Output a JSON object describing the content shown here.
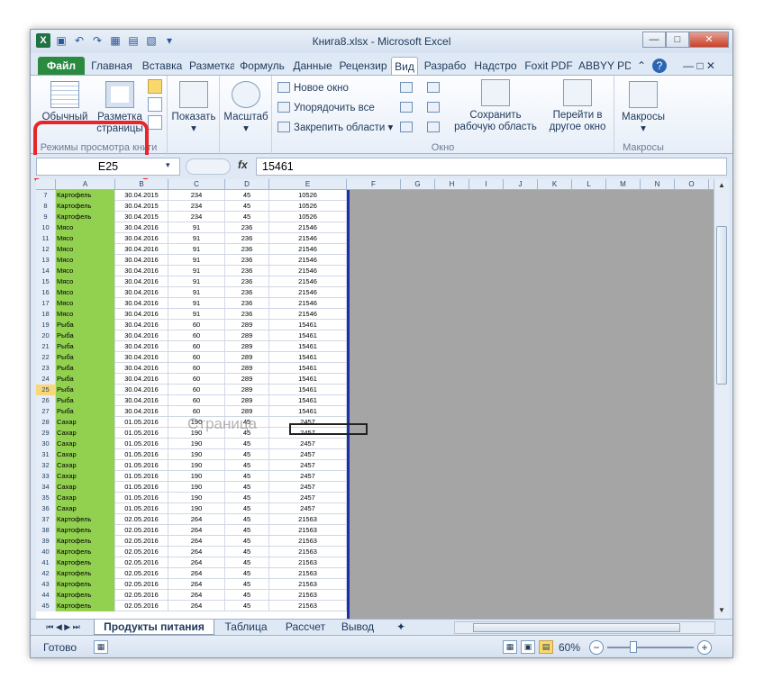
{
  "window": {
    "title": "Книга8.xlsx - Microsoft Excel"
  },
  "ribbon_tabs": [
    "Файл",
    "Главная",
    "Вставка",
    "Разметка",
    "Формуль",
    "Данные",
    "Рецензир",
    "Вид",
    "Разрабо",
    "Надстро",
    "Foxit PDF",
    "ABBYY PD"
  ],
  "ribbon": {
    "normal": "Обычный",
    "page_layout_1": "Разметка",
    "page_layout_2": "страницы",
    "views_group": "Режимы просмотра книги",
    "show": "Показать",
    "zoom": "Масштаб",
    "new_window": "Новое окно",
    "arrange_all": "Упорядочить все",
    "freeze": "Закрепить области",
    "save_ws_1": "Сохранить",
    "save_ws_2": "рабочую область",
    "switch_1": "Перейти в",
    "switch_2": "другое окно",
    "window_group": "Окно",
    "macros": "Макросы",
    "macros_group": "Макросы"
  },
  "formula_bar": {
    "name_box": "E25",
    "fx": "fx",
    "value": "15461"
  },
  "columns": [
    "A",
    "B",
    "C",
    "D",
    "E",
    "F",
    "G",
    "H",
    "I",
    "J",
    "K",
    "L",
    "M",
    "N",
    "O"
  ],
  "rows": [
    [
      "7",
      "Картофель",
      "30.04.2015",
      "234",
      "45",
      "10526"
    ],
    [
      "8",
      "Картофель",
      "30.04.2015",
      "234",
      "45",
      "10526"
    ],
    [
      "9",
      "Картофель",
      "30.04.2015",
      "234",
      "45",
      "10526"
    ],
    [
      "10",
      "Мясо",
      "30.04.2016",
      "91",
      "236",
      "21546"
    ],
    [
      "11",
      "Мясо",
      "30.04.2016",
      "91",
      "236",
      "21546"
    ],
    [
      "12",
      "Мясо",
      "30.04.2016",
      "91",
      "236",
      "21546"
    ],
    [
      "13",
      "Мясо",
      "30.04.2016",
      "91",
      "236",
      "21546"
    ],
    [
      "14",
      "Мясо",
      "30.04.2016",
      "91",
      "236",
      "21546"
    ],
    [
      "15",
      "Мясо",
      "30.04.2016",
      "91",
      "236",
      "21546"
    ],
    [
      "16",
      "Мясо",
      "30.04.2016",
      "91",
      "236",
      "21546"
    ],
    [
      "17",
      "Мясо",
      "30.04.2016",
      "91",
      "236",
      "21546"
    ],
    [
      "18",
      "Мясо",
      "30.04.2016",
      "91",
      "236",
      "21546"
    ],
    [
      "19",
      "Рыба",
      "30.04.2016",
      "60",
      "289",
      "15461"
    ],
    [
      "20",
      "Рыба",
      "30.04.2016",
      "60",
      "289",
      "15461"
    ],
    [
      "21",
      "Рыба",
      "30.04.2016",
      "60",
      "289",
      "15461"
    ],
    [
      "22",
      "Рыба",
      "30.04.2016",
      "60",
      "289",
      "15461"
    ],
    [
      "23",
      "Рыба",
      "30.04.2016",
      "60",
      "289",
      "15461"
    ],
    [
      "24",
      "Рыба",
      "30.04.2016",
      "60",
      "289",
      "15461"
    ],
    [
      "25",
      "Рыба",
      "30.04.2016",
      "60",
      "289",
      "15461"
    ],
    [
      "26",
      "Рыба",
      "30.04.2016",
      "60",
      "289",
      "15461"
    ],
    [
      "27",
      "Рыба",
      "30.04.2016",
      "60",
      "289",
      "15461"
    ],
    [
      "28",
      "Сахар",
      "01.05.2016",
      "190",
      "45",
      "2457"
    ],
    [
      "29",
      "Сахар",
      "01.05.2016",
      "190",
      "45",
      "2457"
    ],
    [
      "30",
      "Сахар",
      "01.05.2016",
      "190",
      "45",
      "2457"
    ],
    [
      "31",
      "Сахар",
      "01.05.2016",
      "190",
      "45",
      "2457"
    ],
    [
      "32",
      "Сахар",
      "01.05.2016",
      "190",
      "45",
      "2457"
    ],
    [
      "33",
      "Сахар",
      "01.05.2016",
      "190",
      "45",
      "2457"
    ],
    [
      "34",
      "Сахар",
      "01.05.2016",
      "190",
      "45",
      "2457"
    ],
    [
      "35",
      "Сахар",
      "01.05.2016",
      "190",
      "45",
      "2457"
    ],
    [
      "36",
      "Сахар",
      "01.05.2016",
      "190",
      "45",
      "2457"
    ],
    [
      "37",
      "Картофель",
      "02.05.2016",
      "264",
      "45",
      "21563"
    ],
    [
      "38",
      "Картофель",
      "02.05.2016",
      "264",
      "45",
      "21563"
    ],
    [
      "39",
      "Картофель",
      "02.05.2016",
      "264",
      "45",
      "21563"
    ],
    [
      "40",
      "Картофель",
      "02.05.2016",
      "264",
      "45",
      "21563"
    ],
    [
      "41",
      "Картофель",
      "02.05.2016",
      "264",
      "45",
      "21563"
    ],
    [
      "42",
      "Картофель",
      "02.05.2016",
      "264",
      "45",
      "21563"
    ],
    [
      "43",
      "Картофель",
      "02.05.2016",
      "264",
      "45",
      "21563"
    ],
    [
      "44",
      "Картофель",
      "02.05.2016",
      "264",
      "45",
      "21563"
    ],
    [
      "45",
      "Картофель",
      "02.05.2016",
      "264",
      "45",
      "21563"
    ]
  ],
  "active_row": "25",
  "watermark": "Страница",
  "sheets": [
    "Продукты питания",
    "Таблица",
    "Рассчет",
    "Вывод"
  ],
  "status": {
    "ready": "Готово",
    "zoom": "60%"
  }
}
